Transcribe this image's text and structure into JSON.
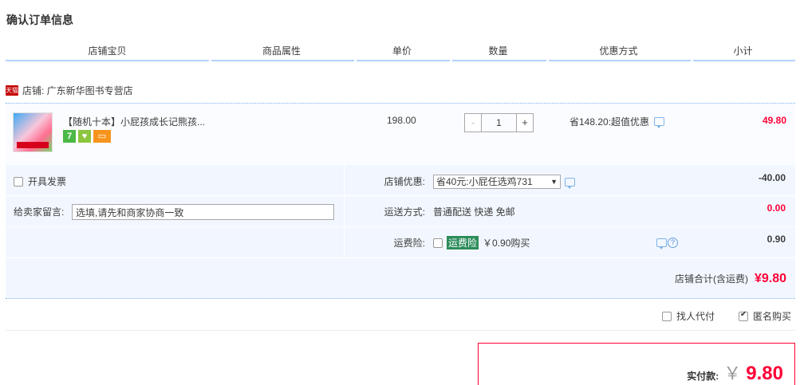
{
  "page": {
    "title": "确认订单信息"
  },
  "columns": [
    "店铺宝贝",
    "商品属性",
    "单价",
    "数量",
    "优惠方式",
    "小计"
  ],
  "shop": {
    "badge": "天猫",
    "label": "店铺: 广东新华图书专营店"
  },
  "item": {
    "title": "【随机十本】小屁孩成长记熊孩...",
    "badges": [
      "7",
      "♥",
      "▭"
    ],
    "price": "198.00",
    "quantity": "1",
    "minus": "-",
    "plus": "+",
    "promo": "省148.20:超值优惠",
    "subtotal": "49.80"
  },
  "options": {
    "invoice_label": "开具发票",
    "shop_discount_label": "店铺优惠:",
    "shop_discount_value": "省40元:小屁任选鸡731",
    "shop_discount_amount": "-40.00",
    "note_label": "给卖家留言:",
    "note_placeholder": "选填,请先和商家协商一致",
    "shipping_label": "运送方式:",
    "shipping_value": "普通配送 快递 免邮",
    "shipping_amount": "0.00",
    "insurance_label": "运费险:",
    "insurance_tag": "运费险",
    "insurance_value": "￥0.90购买",
    "insurance_amount": "0.90",
    "help_icon": "?"
  },
  "shop_total": {
    "label": "店铺合计(含运费)",
    "amount": "¥9.80"
  },
  "extras": {
    "proxy_label": "找人代付",
    "anonymous_label": "匿名购买",
    "anonymous_checked": true
  },
  "payment": {
    "label": "实付款:",
    "currency": "￥",
    "amount": "9.80"
  },
  "colors": {
    "accent_red": "#ff0036",
    "blue_border": "#b2d1ff",
    "option_bg": "#f2f7ff"
  }
}
